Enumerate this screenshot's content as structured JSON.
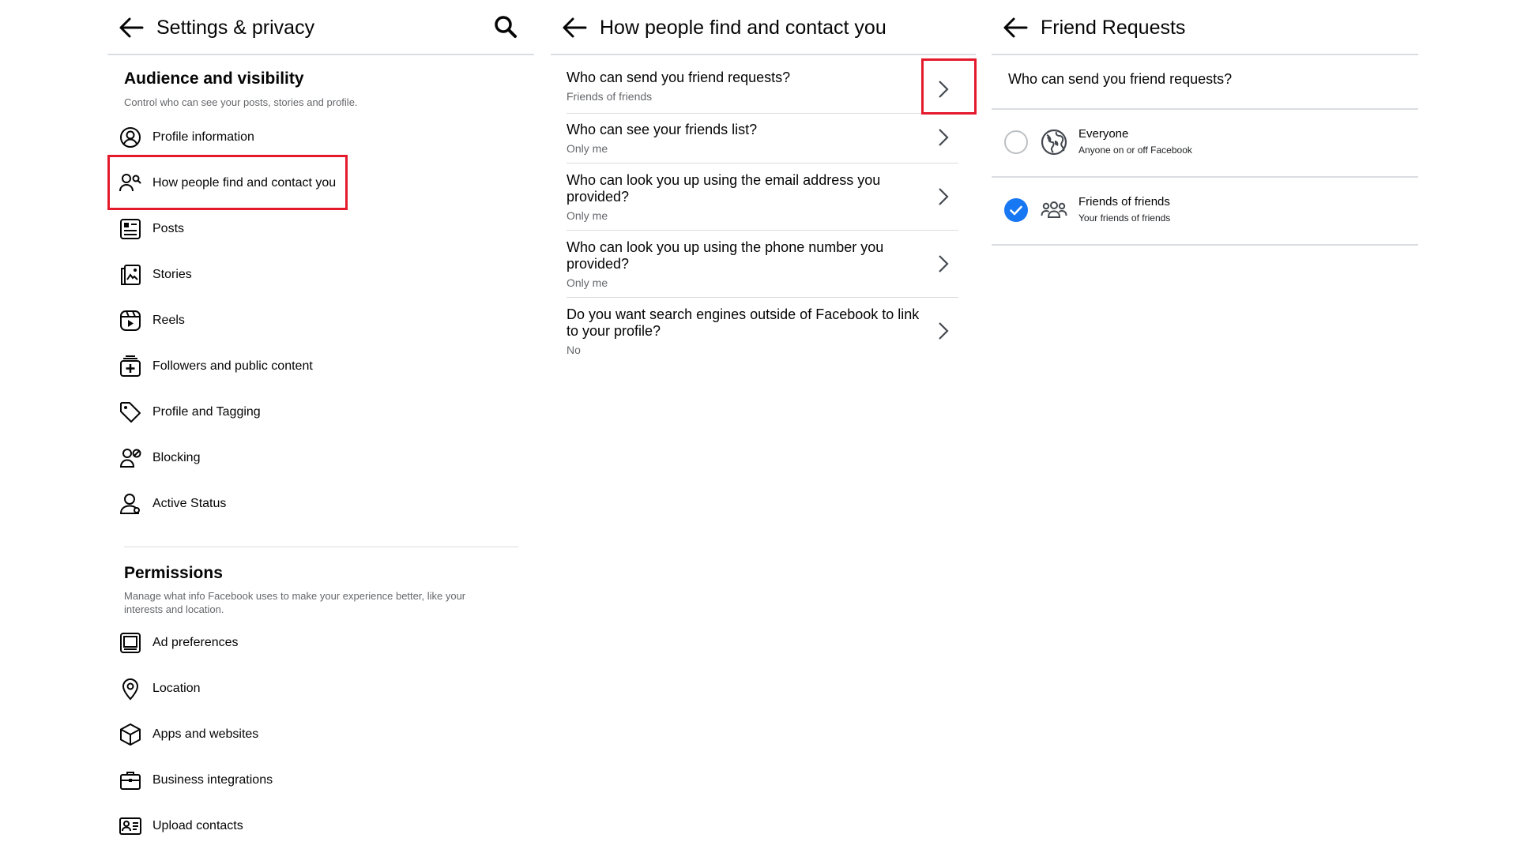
{
  "panel1": {
    "title": "Settings & privacy",
    "audience": {
      "title": "Audience and visibility",
      "description": "Control who can see your posts, stories and profile.",
      "items": [
        {
          "label": "Profile information",
          "icon": "profile-circle-icon"
        },
        {
          "label": "How people find and contact you",
          "icon": "person-search-icon"
        },
        {
          "label": "Posts",
          "icon": "posts-icon"
        },
        {
          "label": "Stories",
          "icon": "stories-icon"
        },
        {
          "label": "Reels",
          "icon": "reels-icon"
        },
        {
          "label": "Followers and public content",
          "icon": "followers-icon"
        },
        {
          "label": "Profile and Tagging",
          "icon": "tag-icon"
        },
        {
          "label": "Blocking",
          "icon": "blocking-icon"
        },
        {
          "label": "Active Status",
          "icon": "active-status-icon"
        }
      ]
    },
    "permissions": {
      "title": "Permissions",
      "description": "Manage what info Facebook uses to make your experience better, like your interests and location.",
      "items": [
        {
          "label": "Ad preferences",
          "icon": "ad-preferences-icon"
        },
        {
          "label": "Location",
          "icon": "location-pin-icon"
        },
        {
          "label": "Apps and websites",
          "icon": "cube-icon"
        },
        {
          "label": "Business integrations",
          "icon": "briefcase-icon"
        },
        {
          "label": "Upload contacts",
          "icon": "contact-card-icon"
        }
      ]
    }
  },
  "panel2": {
    "title": "How people find and contact you",
    "rows": [
      {
        "question": "Who can send you friend requests?",
        "value": "Friends of friends"
      },
      {
        "question": "Who can see your friends list?",
        "value": "Only me"
      },
      {
        "question": "Who can look you up using the email address you provided?",
        "value": "Only me"
      },
      {
        "question": "Who can look you up using the phone number you provided?",
        "value": "Only me"
      },
      {
        "question": "Do you want search engines outside of Facebook to link to your profile?",
        "value": "No"
      }
    ]
  },
  "panel3": {
    "title": "Friend Requests",
    "question": "Who can send you friend requests?",
    "options": [
      {
        "label": "Everyone",
        "sublabel": "Anyone on or off Facebook",
        "selected": false,
        "icon": "globe-icon"
      },
      {
        "label": "Friends of friends",
        "sublabel": "Your friends of friends",
        "selected": true,
        "icon": "friends-group-icon"
      }
    ]
  },
  "colors": {
    "highlight": "#e4192c",
    "accent": "#1877f2",
    "divider": "#dadde1",
    "secondary_text": "#65676b"
  }
}
